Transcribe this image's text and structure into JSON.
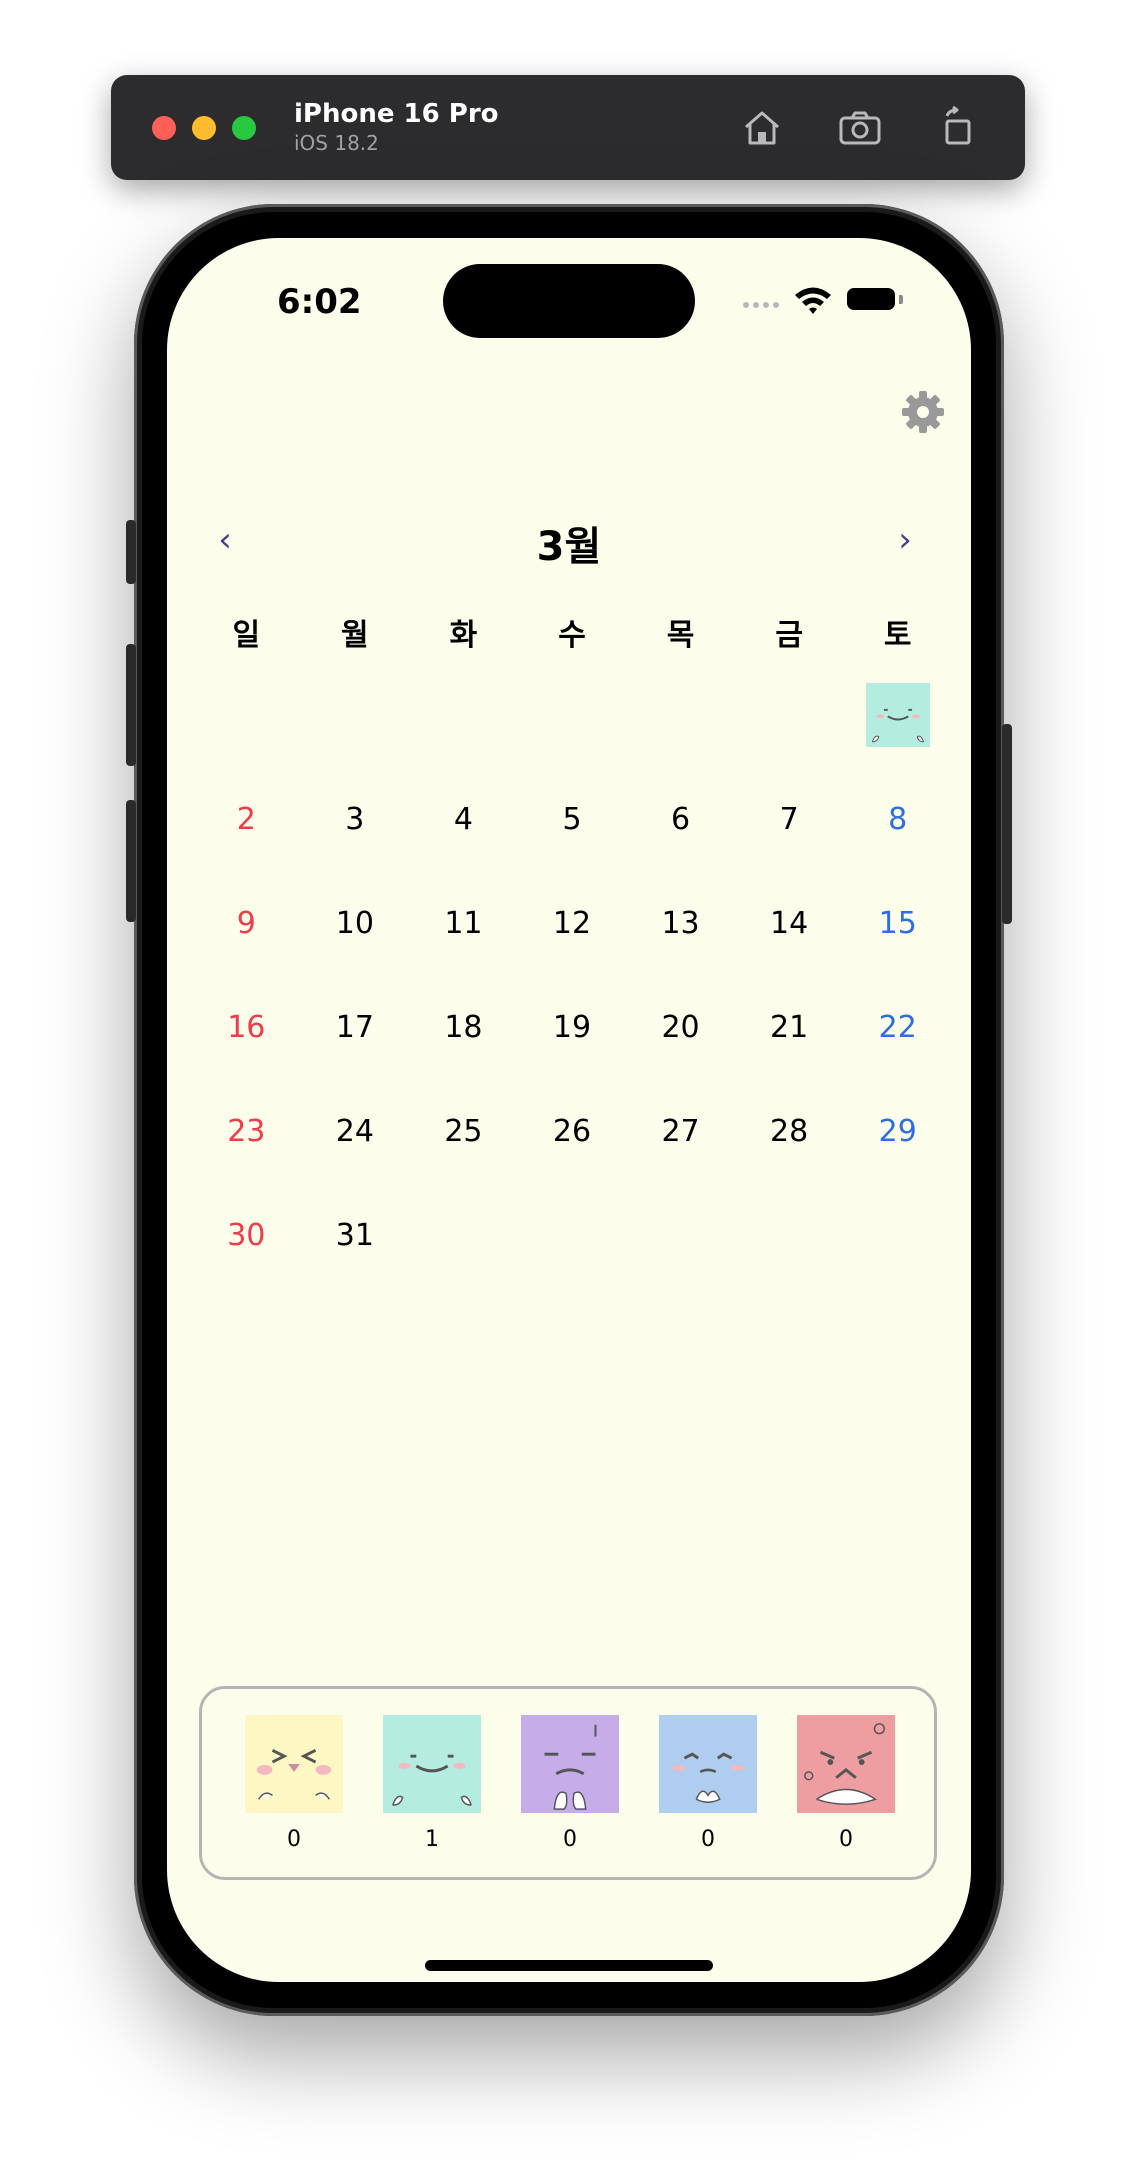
{
  "simulator": {
    "device_name": "iPhone 16 Pro",
    "os_version": "iOS 18.2",
    "buttons": [
      "home-icon",
      "screenshot-icon",
      "rotate-icon"
    ]
  },
  "status_bar": {
    "time": "6:02"
  },
  "calendar": {
    "month_title": "3월",
    "prev_label": "‹",
    "next_label": "›",
    "weekdays": [
      "일",
      "월",
      "화",
      "수",
      "목",
      "금",
      "토"
    ],
    "colors": {
      "sunday": "#ee3d4a",
      "saturday": "#2f6ee0",
      "weekday": "#000000",
      "background": "#fdfdeb"
    },
    "weeks": [
      [
        "",
        "",
        "",
        "",
        "",
        "",
        {
          "mood": "calm"
        }
      ],
      [
        "2",
        "3",
        "4",
        "5",
        "6",
        "7",
        "8"
      ],
      [
        "9",
        "10",
        "11",
        "12",
        "13",
        "14",
        "15"
      ],
      [
        "16",
        "17",
        "18",
        "19",
        "20",
        "21",
        "22"
      ],
      [
        "23",
        "24",
        "25",
        "26",
        "27",
        "28",
        "29"
      ],
      [
        "30",
        "31",
        "",
        "",
        "",
        "",
        ""
      ]
    ]
  },
  "mood_summary": [
    {
      "mood": "happy",
      "color": "#fdf7c4",
      "count": "0"
    },
    {
      "mood": "calm",
      "color": "#b4ece0",
      "count": "1"
    },
    {
      "mood": "annoyed",
      "color": "#c7acea",
      "count": "0"
    },
    {
      "mood": "sad",
      "color": "#afcdee",
      "count": "0"
    },
    {
      "mood": "angry",
      "color": "#ee9da0",
      "count": "0"
    }
  ]
}
